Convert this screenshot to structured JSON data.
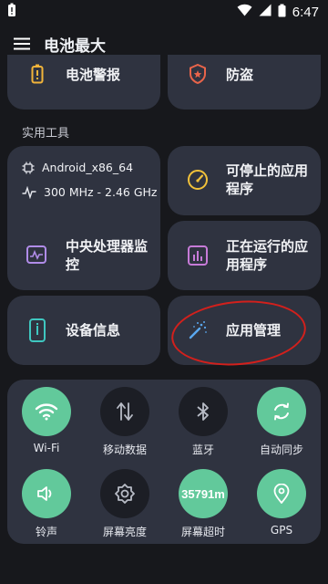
{
  "status_bar": {
    "time": "6:47"
  },
  "app_bar": {
    "title": "电池最大"
  },
  "top_cards": {
    "battery_alert": "电池警报",
    "anti_theft": "防盗"
  },
  "section": {
    "tools_label": "实用工具"
  },
  "device_specs": {
    "model": "Android_x86_64",
    "cpu_freq": "300 MHz - 2.46 GHz"
  },
  "cards": {
    "stoppable_apps": "可停止的应用程序",
    "cpu_monitor": "中央处理器监控",
    "running_apps": "正在运行的应用程序",
    "device_info": "设备信息",
    "app_management": "应用管理"
  },
  "quick_settings": [
    {
      "label": "Wi-Fi",
      "icon": "wifi-icon",
      "state": "on"
    },
    {
      "label": "移动数据",
      "icon": "mobile-data-icon",
      "state": "off"
    },
    {
      "label": "蓝牙",
      "icon": "bluetooth-icon",
      "state": "off"
    },
    {
      "label": "自动同步",
      "icon": "sync-icon",
      "state": "on"
    },
    {
      "label": "铃声",
      "icon": "volume-icon",
      "state": "on"
    },
    {
      "label": "屏幕亮度",
      "icon": "brightness-icon",
      "state": "off"
    },
    {
      "label": "屏幕超时",
      "icon": "screen-timeout-icon",
      "state": "on",
      "value": "35791m"
    },
    {
      "label": "GPS",
      "icon": "location-icon",
      "state": "on"
    }
  ],
  "colors": {
    "background": "#17181c",
    "card": "#2f3340",
    "accent_green": "#62c99b",
    "annotation_red": "#d2201c"
  }
}
